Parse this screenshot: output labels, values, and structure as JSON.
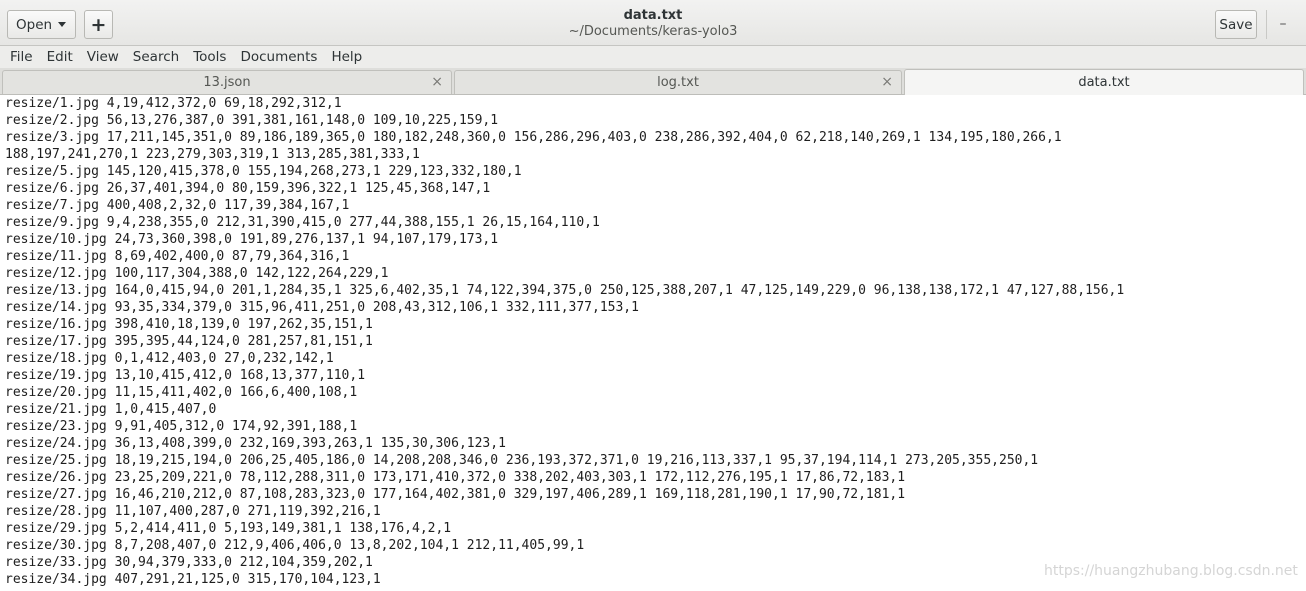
{
  "header": {
    "open_label": "Open",
    "new_tab_label": "+",
    "title": "data.txt",
    "subtitle": "~/Documents/keras-yolo3",
    "save_label": "Save",
    "minimize_label": "–"
  },
  "menu": [
    "File",
    "Edit",
    "View",
    "Search",
    "Tools",
    "Documents",
    "Help"
  ],
  "tabs": [
    {
      "label": "13.json",
      "close": "×"
    },
    {
      "label": "log.txt",
      "close": "×"
    },
    {
      "label": "data.txt"
    }
  ],
  "lines": [
    "resize/1.jpg 4,19,412,372,0 69,18,292,312,1",
    "resize/2.jpg 56,13,276,387,0 391,381,161,148,0 109,10,225,159,1",
    "resize/3.jpg 17,211,145,351,0 89,186,189,365,0 180,182,248,360,0 156,286,296,403,0 238,286,392,404,0 62,218,140,269,1 134,195,180,266,1",
    "188,197,241,270,1 223,279,303,319,1 313,285,381,333,1",
    "resize/5.jpg 145,120,415,378,0 155,194,268,273,1 229,123,332,180,1",
    "resize/6.jpg 26,37,401,394,0 80,159,396,322,1 125,45,368,147,1",
    "resize/7.jpg 400,408,2,32,0 117,39,384,167,1",
    "resize/9.jpg 9,4,238,355,0 212,31,390,415,0 277,44,388,155,1 26,15,164,110,1",
    "resize/10.jpg 24,73,360,398,0 191,89,276,137,1 94,107,179,173,1",
    "resize/11.jpg 8,69,402,400,0 87,79,364,316,1",
    "resize/12.jpg 100,117,304,388,0 142,122,264,229,1",
    "resize/13.jpg 164,0,415,94,0 201,1,284,35,1 325,6,402,35,1 74,122,394,375,0 250,125,388,207,1 47,125,149,229,0 96,138,138,172,1 47,127,88,156,1",
    "resize/14.jpg 93,35,334,379,0 315,96,411,251,0 208,43,312,106,1 332,111,377,153,1",
    "resize/16.jpg 398,410,18,139,0 197,262,35,151,1",
    "resize/17.jpg 395,395,44,124,0 281,257,81,151,1",
    "resize/18.jpg 0,1,412,403,0 27,0,232,142,1",
    "resize/19.jpg 13,10,415,412,0 168,13,377,110,1",
    "resize/20.jpg 11,15,411,402,0 166,6,400,108,1",
    "resize/21.jpg 1,0,415,407,0",
    "resize/23.jpg 9,91,405,312,0 174,92,391,188,1",
    "resize/24.jpg 36,13,408,399,0 232,169,393,263,1 135,30,306,123,1",
    "resize/25.jpg 18,19,215,194,0 206,25,405,186,0 14,208,208,346,0 236,193,372,371,0 19,216,113,337,1 95,37,194,114,1 273,205,355,250,1",
    "resize/26.jpg 23,25,209,221,0 78,112,288,311,0 173,171,410,372,0 338,202,403,303,1 172,112,276,195,1 17,86,72,183,1",
    "resize/27.jpg 16,46,210,212,0 87,108,283,323,0 177,164,402,381,0 329,197,406,289,1 169,118,281,190,1 17,90,72,181,1",
    "resize/28.jpg 11,107,400,287,0 271,119,392,216,1",
    "resize/29.jpg 5,2,414,411,0 5,193,149,381,1 138,176,4,2,1",
    "resize/30.jpg 8,7,208,407,0 212,9,406,406,0 13,8,202,104,1 212,11,405,99,1",
    "resize/33.jpg 30,94,379,333,0 212,104,359,202,1",
    "resize/34.jpg 407,291,21,125,0 315,170,104,123,1"
  ],
  "watermark": "https://huangzhubang.blog.csdn.net"
}
